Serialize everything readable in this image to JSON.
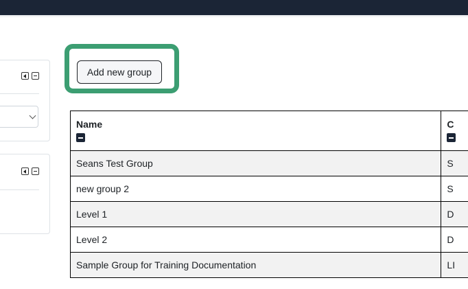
{
  "header": {},
  "add_group_button": {
    "label": "Add new group"
  },
  "table": {
    "headers": [
      {
        "label": "Name"
      },
      {
        "label": "C"
      }
    ],
    "rows": [
      {
        "name": "Seans Test Group",
        "col2": "S"
      },
      {
        "name": "new group 2",
        "col2": "S"
      },
      {
        "name": "Level 1",
        "col2": "D"
      },
      {
        "name": "Level 2",
        "col2": "D"
      },
      {
        "name": "Sample Group for Training Documentation",
        "col2": "LI"
      }
    ]
  },
  "colors": {
    "topbar": "#1b2536",
    "highlight": "#3c9e72",
    "row_stripe": "#f2f2f2"
  },
  "icons": [
    "move-left-icon",
    "collapse-icon",
    "chevron-down-icon",
    "column-collapse-icon"
  ]
}
